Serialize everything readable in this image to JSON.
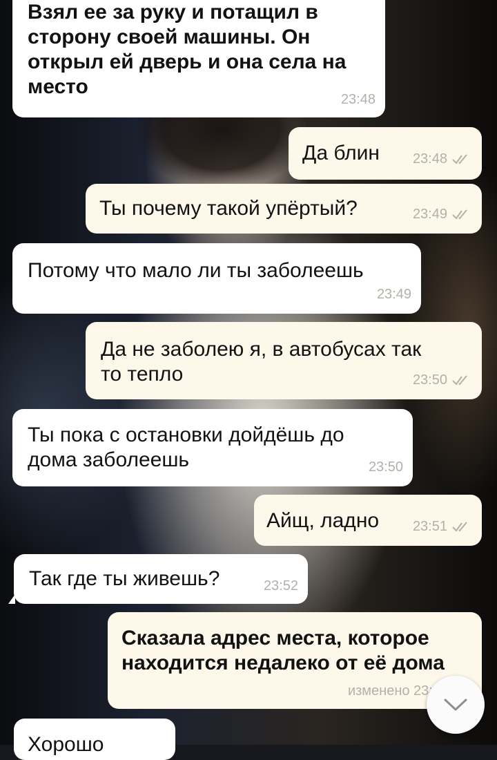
{
  "messages": [
    {
      "text": "Взял ее за руку и потащил в\nсторону своей машины. Он\nоткрыл ей дверь и она села на\nместо",
      "time": "23:48"
    },
    {
      "text": "Да блин",
      "time": "23:48"
    },
    {
      "text": "Ты почему такой упёртый?",
      "time": "23:49"
    },
    {
      "text": "Потому что мало ли ты заболеешь",
      "time": "23:49"
    },
    {
      "text": "Да не заболею я, в автобусах так\nто тепло",
      "time": "23:50"
    },
    {
      "text": "Ты пока с остановки дойдёшь до\nдома заболеешь",
      "time": "23:50"
    },
    {
      "text": "Айщ, ладно",
      "time": "23:51"
    },
    {
      "text": "Так где ты живешь?",
      "time": "23:52"
    },
    {
      "text": "Сказала адрес места, которое\nнаходится недалеко от её дома",
      "time": "изменено 23:5"
    },
    {
      "text": "Хорошо",
      "time": ""
    }
  ],
  "icons": {
    "read_receipt": "double-check-icon",
    "scroll_down": "chevron-down-icon"
  },
  "colors": {
    "incoming_bubble": "#ffffff",
    "outgoing_bubble": "#fdf8ea",
    "meta_text": "#b3b0a8"
  }
}
